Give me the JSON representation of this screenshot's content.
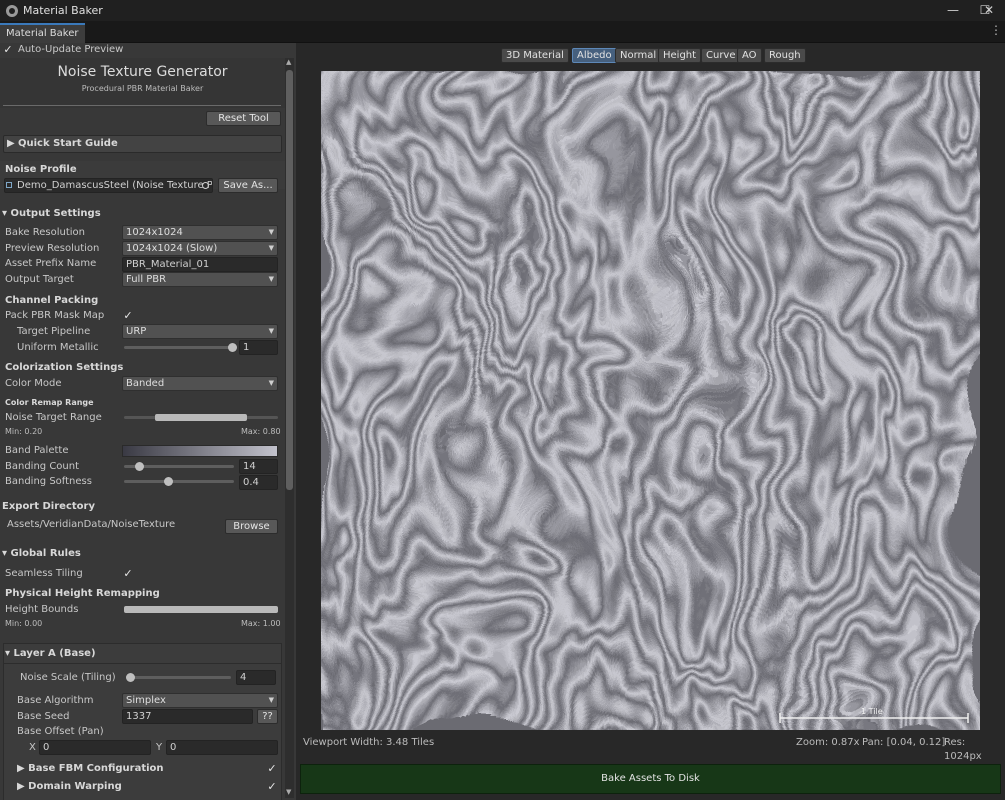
{
  "window": {
    "title": "Material Baker",
    "icon": "unity-cube-icon",
    "minimize": "—",
    "maximize": "☐",
    "close": "✕"
  },
  "tab": {
    "label": "Material Baker",
    "menu_icon": "⋮"
  },
  "auto_update": {
    "label": "Auto-Update Preview",
    "checked": true
  },
  "header": {
    "title": "Noise Texture Generator",
    "subtitle": "Procedural PBR Material Baker"
  },
  "reset_button": "Reset Tool",
  "quick_start": "Quick Start Guide",
  "noise_profile": {
    "heading": "Noise Profile",
    "value": "Demo_DamascusSteel (Noise Texture Pro",
    "save_as": "Save As..."
  },
  "output_settings": {
    "heading": "Output Settings",
    "bake_resolution": {
      "label": "Bake Resolution",
      "value": "1024x1024"
    },
    "preview_resolution": {
      "label": "Preview Resolution",
      "value": "1024x1024 (Slow)"
    },
    "asset_prefix": {
      "label": "Asset Prefix Name",
      "value": "PBR_Material_01"
    },
    "output_target": {
      "label": "Output Target",
      "value": "Full PBR"
    }
  },
  "channel_packing": {
    "heading": "Channel Packing",
    "pack_mask": {
      "label": "Pack PBR Mask Map",
      "checked": true
    },
    "target_pipeline": {
      "label": "Target Pipeline",
      "value": "URP"
    },
    "uniform_metallic": {
      "label": "Uniform Metallic",
      "value": "1",
      "fraction": 1.0
    }
  },
  "colorization": {
    "heading": "Colorization Settings",
    "color_mode": {
      "label": "Color Mode",
      "value": "Banded"
    },
    "remap_heading": "Color Remap Range",
    "noise_target_range": {
      "label": "Noise Target Range",
      "min_text": "Min: 0.20",
      "max_text": "Max: 0.80",
      "min": 0.2,
      "max": 0.8
    },
    "band_palette": {
      "label": "Band Palette",
      "from": "#3a3a44",
      "to": "#c2c2cc"
    },
    "banding_count": {
      "label": "Banding Count",
      "value": "14",
      "fraction": 0.14
    },
    "banding_softness": {
      "label": "Banding Softness",
      "value": "0.4",
      "fraction": 0.4
    }
  },
  "export": {
    "heading": "Export Directory",
    "path": "Assets/VeridianData/NoiseTexture",
    "browse": "Browse"
  },
  "global_rules": {
    "heading": "Global Rules",
    "seamless": {
      "label": "Seamless Tiling",
      "checked": true
    },
    "height_heading": "Physical Height Remapping",
    "height_bounds": {
      "label": "Height Bounds",
      "min_text": "Min: 0.00",
      "max_text": "Max: 1.00",
      "min": 0.0,
      "max": 1.0
    }
  },
  "layer_a": {
    "heading": "Layer A (Base)",
    "noise_scale": {
      "label": "Noise Scale (Tiling)",
      "value": "4",
      "fraction": 0.04
    },
    "base_algorithm": {
      "label": "Base Algorithm",
      "value": "Simplex"
    },
    "base_seed": {
      "label": "Base Seed",
      "value": "1337",
      "random": "??"
    },
    "base_offset": {
      "label": "Base Offset (Pan)",
      "x_label": "X",
      "x": "0",
      "y_label": "Y",
      "y": "0"
    },
    "fbm": {
      "label": "Base FBM Configuration",
      "checked": true
    },
    "warping": {
      "label": "Domain Warping",
      "checked": true
    }
  },
  "preview_tabs": [
    {
      "label": "3D Material",
      "active": false
    },
    {
      "label": "Albedo",
      "active": true
    },
    {
      "label": "Normal",
      "active": false
    },
    {
      "label": "Height",
      "active": false
    },
    {
      "label": "Curve",
      "active": false
    },
    {
      "label": "AO",
      "active": false
    },
    {
      "label": "Rough",
      "active": false
    }
  ],
  "scale_bar": {
    "label": "1 Tile"
  },
  "status": {
    "viewport": "Viewport Width: 3.48 Tiles",
    "zoom": "Zoom: 0.87x",
    "pan": "Pan: [0.04, 0.12]",
    "res": "Res: 1024px"
  },
  "bake_button": "Bake Assets To Disk",
  "colors": {
    "accent": "#3a79bb",
    "bake": "#173717",
    "texture_light": "#c9c9d0",
    "texture_dark": "#6c6c74"
  }
}
